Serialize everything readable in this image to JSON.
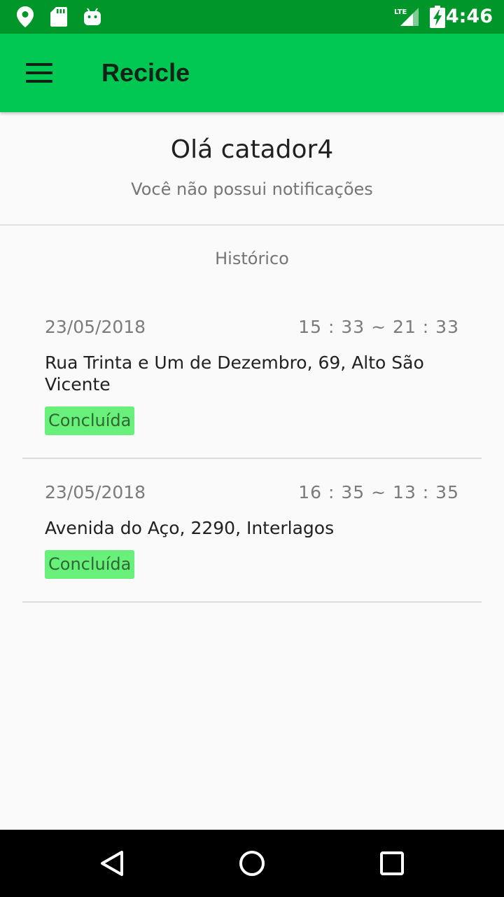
{
  "status_bar": {
    "time": "4:46",
    "network": "LTE",
    "icons": [
      "location-icon",
      "sd-card-icon",
      "android-icon",
      "lte-signal-icon",
      "battery-charging-icon"
    ]
  },
  "app_bar": {
    "title": "Recicle",
    "menu_icon": "menu-icon"
  },
  "header": {
    "greeting": "Olá catador4",
    "subtitle": "Você não possui notificações"
  },
  "history": {
    "title": "Histórico",
    "items": [
      {
        "date": "23/05/2018",
        "time_range": "15 : 33  ~  21 : 33",
        "address": "Rua Trinta e Um de Dezembro, 69, Alto São Vicente",
        "status": "Concluída"
      },
      {
        "date": "23/05/2018",
        "time_range": "16 : 35  ~  13 : 35",
        "address": "Avenida do Aço, 2290, Interlagos",
        "status": "Concluída"
      }
    ]
  },
  "nav_bar": {
    "buttons": [
      "back-icon",
      "home-icon",
      "recents-icon"
    ]
  },
  "colors": {
    "status_bar": "#00962a",
    "app_bar": "#00c853",
    "status_badge": "#69f07a",
    "background": "#fafafa"
  }
}
